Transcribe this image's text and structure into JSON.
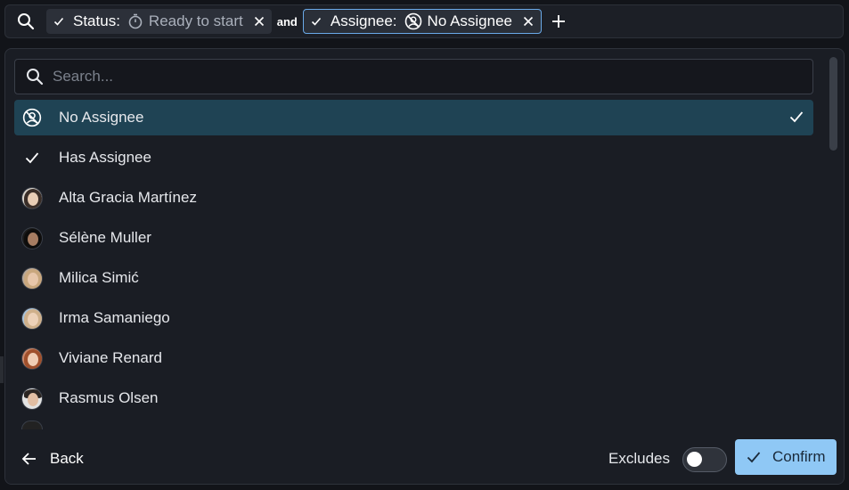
{
  "filter_bar": {
    "chips": [
      {
        "label": "Status:",
        "value": "Ready to start",
        "value_icon": "stopwatch-icon"
      },
      {
        "label": "Assignee:",
        "value": "No Assignee",
        "value_icon": "no-assignee-icon"
      }
    ],
    "conjunction": "and"
  },
  "dropdown": {
    "search_placeholder": "Search...",
    "search_value": "",
    "options": [
      {
        "label": "No Assignee",
        "icon": "no-assignee-icon",
        "selected": true
      },
      {
        "label": "Has Assignee",
        "icon": "check-icon",
        "selected": false
      },
      {
        "label": "Alta Gracia Martínez",
        "icon": "avatar",
        "selected": false
      },
      {
        "label": "Sélène Muller",
        "icon": "avatar",
        "selected": false
      },
      {
        "label": "Milica Simić",
        "icon": "avatar",
        "selected": false
      },
      {
        "label": "Irma Samaniego",
        "icon": "avatar",
        "selected": false
      },
      {
        "label": "Viviane Renard",
        "icon": "avatar",
        "selected": false
      },
      {
        "label": "Rasmus Olsen",
        "icon": "avatar",
        "selected": false
      }
    ]
  },
  "footer": {
    "back_label": "Back",
    "excludes_label": "Excludes",
    "excludes_on": false,
    "confirm_label": "Confirm"
  },
  "colors": {
    "selected_row": "#1f4354",
    "confirm_bg": "#8fc8f5",
    "active_chip_border": "#6aa9e8"
  }
}
